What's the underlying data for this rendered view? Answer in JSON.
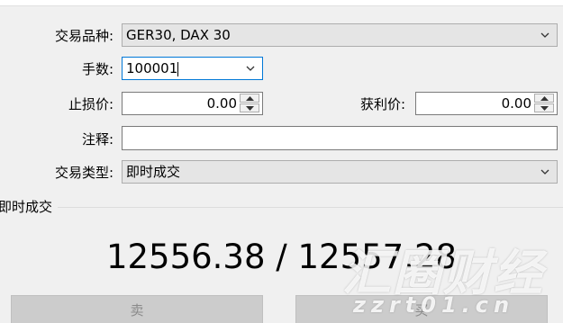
{
  "form": {
    "symbol_label": "交易品种:",
    "symbol_value": "GER30, DAX 30",
    "volume_label": "手数:",
    "volume_value": "100001",
    "stoploss_label": "止损价:",
    "stoploss_value": "0.00",
    "takeprofit_label": "获利价:",
    "takeprofit_value": "0.00",
    "comment_label": "注释:",
    "comment_value": "",
    "type_label": "交易类型:",
    "type_value": "即时成交"
  },
  "execution": {
    "section_label": "即时成交",
    "price_text": "12556.38 / 12557.28",
    "sell_label": "卖",
    "buy_label": "买"
  },
  "watermark": {
    "brand": "汇圈财经",
    "url": "zzrt01.cn"
  },
  "icons": {
    "dropdown": "chevron-down-icon",
    "spin_up": "spin-up-icon",
    "spin_down": "spin-down-icon"
  },
  "colors": {
    "window_bg": "#f0f0f0",
    "focus_border": "#0078d7",
    "disabled_button": "#cccccc"
  }
}
